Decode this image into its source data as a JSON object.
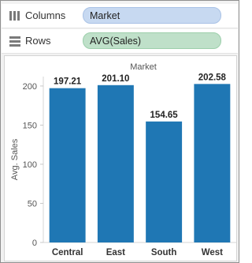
{
  "shelves": {
    "columns_label": "Columns",
    "columns_pill": "Market",
    "rows_label": "Rows",
    "rows_pill": "AVG(Sales)"
  },
  "chart_data": {
    "type": "bar",
    "title": "Market",
    "ylabel": "Avg. Sales",
    "xlabel": "",
    "categories": [
      "Central",
      "East",
      "South",
      "West"
    ],
    "values": [
      197.21,
      201.1,
      154.65,
      202.58
    ],
    "value_labels": [
      "197.21",
      "201.10",
      "154.65",
      "202.58"
    ],
    "ylim": [
      0,
      212
    ],
    "yticks": [
      0,
      50,
      100,
      150,
      200
    ],
    "bar_color": "#1f77b4",
    "grid": false
  }
}
